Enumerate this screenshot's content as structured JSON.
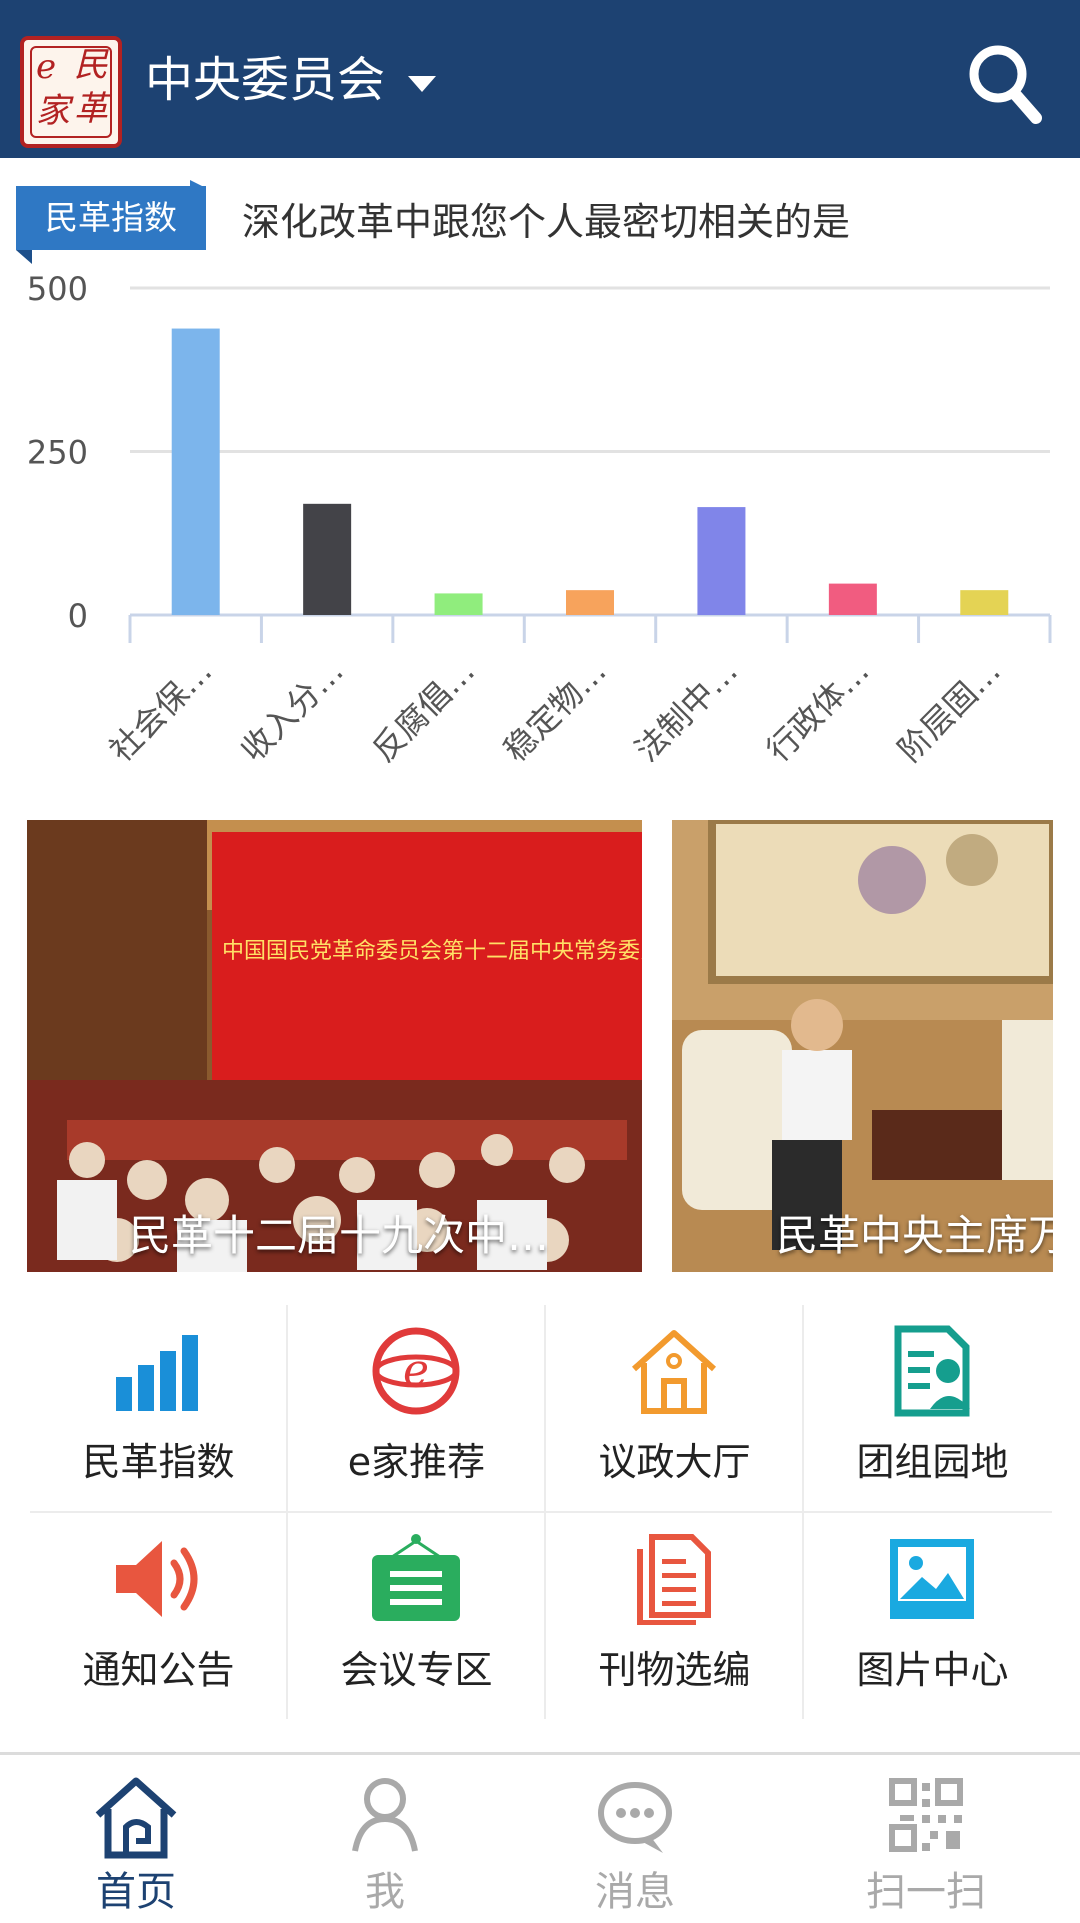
{
  "header": {
    "logo_chars": [
      "e",
      "民",
      "家",
      "革"
    ],
    "title": "中央委员会",
    "background": "#1d4272"
  },
  "index_section": {
    "tag": "民革指数",
    "question": "深化改革中跟您个人最密切相关的是"
  },
  "chart_data": {
    "type": "bar",
    "title": "深化改革中跟您个人最密切相关的是",
    "categories": [
      "社会保…",
      "收入分…",
      "反腐倡…",
      "稳定物…",
      "法制中…",
      "行政体…",
      "阶层固…"
    ],
    "values": [
      438,
      170,
      33,
      38,
      165,
      48,
      38
    ],
    "colors": [
      "#7cb5ec",
      "#434348",
      "#90ed7d",
      "#f7a35c",
      "#8085e9",
      "#f15c80",
      "#e4d354"
    ],
    "ylim": [
      0,
      500
    ],
    "yticks": [
      "500",
      "250",
      "0"
    ],
    "grid": true,
    "legend": "none"
  },
  "photos": [
    {
      "caption": "民革十二届十九次中…",
      "banner_text": "中国国民党革命委员会第十二届中央常务委员会第十九次会议"
    },
    {
      "caption": "民革中央主席万"
    }
  ],
  "grid_items": [
    {
      "label": "民革指数",
      "icon": "bar-chart-icon",
      "color": "#1a8fd8"
    },
    {
      "label": "e家推荐",
      "icon": "e-logo-icon",
      "color": "#e03a3a"
    },
    {
      "label": "议政大厅",
      "icon": "house-icon",
      "color": "#f29a2e"
    },
    {
      "label": "团组园地",
      "icon": "contact-card-icon",
      "color": "#159e8e"
    },
    {
      "label": "通知公告",
      "icon": "speaker-icon",
      "color": "#e8563f"
    },
    {
      "label": "会议专区",
      "icon": "meeting-board-icon",
      "color": "#2aad5e"
    },
    {
      "label": "刊物选编",
      "icon": "document-icon",
      "color": "#e8563f"
    },
    {
      "label": "图片中心",
      "icon": "picture-icon",
      "color": "#1aa9e0"
    }
  ],
  "bottom_nav": [
    {
      "label": "首页",
      "icon": "home-icon",
      "active": true
    },
    {
      "label": "我",
      "icon": "person-icon",
      "active": false
    },
    {
      "label": "消息",
      "icon": "chat-icon",
      "active": false
    },
    {
      "label": "扫一扫",
      "icon": "qr-code-icon",
      "active": false
    }
  ],
  "colors": {
    "active_nav": "#1d4272",
    "inactive_nav": "#a9a9a9"
  }
}
